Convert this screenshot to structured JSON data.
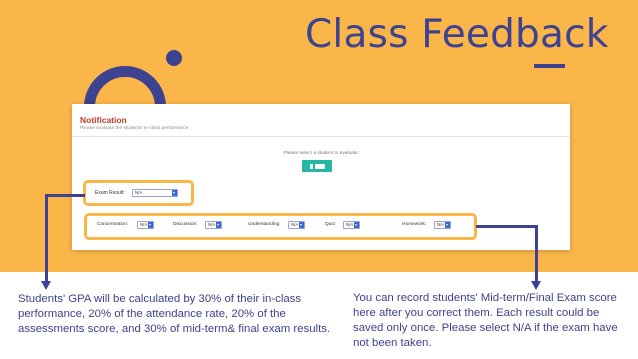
{
  "slide": {
    "title": "Class Feedback",
    "colors": {
      "background": "#fbb649",
      "accent": "#3d4291",
      "notification_title": "#c0392b",
      "button": "#26b6a4"
    }
  },
  "panel": {
    "notification_title": "Notification",
    "notification_subtitle": "Please evaluate the students' in-class performance",
    "select_prompt": "Please select a student to evaluate :",
    "student_button_icon": "student-card-icon",
    "exam_result_label": "Exam Result:",
    "exam_result_value": "N/A",
    "ratings": [
      {
        "label": "Concentration:",
        "value": "N/A"
      },
      {
        "label": "Discussion:",
        "value": "N/A"
      },
      {
        "label": "Understanding:",
        "value": "N/A"
      },
      {
        "label": "Quiz:",
        "value": "N/A"
      },
      {
        "label": "Homework:",
        "value": "N/A"
      }
    ]
  },
  "captions": {
    "left": "Students' GPA will be calculated by 30% of their in-class performance, 20% of the attendance rate, 20% of the assessments score, and 30% of mid-term& final exam results.",
    "right": "You can record students' Mid-term/Final Exam score here after you correct them. Each result could be saved only once. Please select N/A if the exam have not been taken."
  }
}
